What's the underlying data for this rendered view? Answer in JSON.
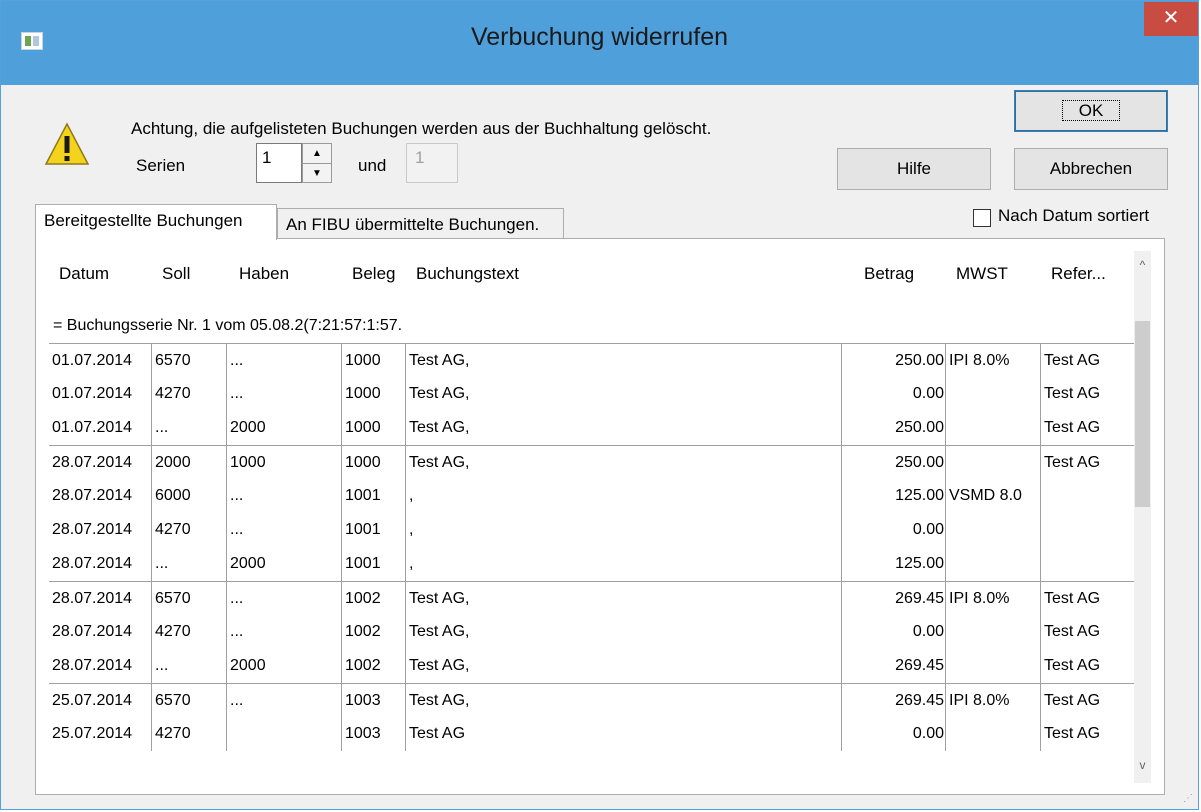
{
  "window": {
    "title": "Verbuchung widerrufen",
    "close_glyph": "✕"
  },
  "warning": {
    "icon": "warning-icon",
    "text": "Achtung, die aufgelisteten Buchungen werden aus der Buchhaltung gelöscht."
  },
  "series": {
    "label": "Serien",
    "from_value": "1",
    "and_label": "und",
    "to_value": "1"
  },
  "buttons": {
    "ok": "OK",
    "help": "Hilfe",
    "cancel": "Abbrechen"
  },
  "tabs": [
    {
      "label": "Bereitgestellte Buchungen",
      "active": true
    },
    {
      "label": "An FIBU übermittelte Buchungen.",
      "active": false
    }
  ],
  "sort": {
    "label": "Nach Datum sortiert",
    "checked": false
  },
  "table": {
    "columns": [
      "Datum",
      "Soll",
      "Haben",
      "Beleg",
      "Buchungstext",
      "Betrag",
      "MWST",
      "Refer..."
    ],
    "series_header": "= Buchungsserie Nr. 1 vom 05.08.2(7:21:57:1:57.",
    "groups": [
      {
        "rows": [
          [
            "01.07.2014",
            "6570",
            "...",
            "1000",
            "Test AG,",
            "250.00",
            "IPI 8.0%",
            "Test AG"
          ],
          [
            "01.07.2014",
            "4270",
            "...",
            "1000",
            "Test AG,",
            "0.00",
            "",
            "Test AG"
          ],
          [
            "01.07.2014",
            "...",
            "2000",
            "1000",
            "Test AG,",
            "250.00",
            "",
            "Test AG"
          ]
        ]
      },
      {
        "rows": [
          [
            "28.07.2014",
            "2000",
            "1000",
            "1000",
            "Test AG,",
            "250.00",
            "",
            "Test AG"
          ],
          [
            "28.07.2014",
            "6000",
            "...",
            "1001",
            ",",
            "125.00",
            "VSMD 8.0",
            ""
          ],
          [
            "28.07.2014",
            "4270",
            "...",
            "1001",
            ",",
            "0.00",
            "",
            ""
          ],
          [
            "28.07.2014",
            "...",
            "2000",
            "1001",
            ",",
            "125.00",
            "",
            ""
          ]
        ]
      },
      {
        "rows": [
          [
            "28.07.2014",
            "6570",
            "...",
            "1002",
            "Test AG,",
            "269.45",
            "IPI 8.0%",
            "Test AG"
          ],
          [
            "28.07.2014",
            "4270",
            "...",
            "1002",
            "Test AG,",
            "0.00",
            "",
            "Test AG"
          ],
          [
            "28.07.2014",
            "...",
            "2000",
            "1002",
            "Test AG,",
            "269.45",
            "",
            "Test AG"
          ]
        ]
      },
      {
        "rows": [
          [
            "25.07.2014",
            "6570",
            "...",
            "1003",
            "Test AG,",
            "269.45",
            "IPI 8.0%",
            "Test AG"
          ],
          [
            "25.07.2014",
            "4270",
            "",
            "1003",
            "Test AG",
            "0.00",
            "",
            "Test AG"
          ]
        ]
      }
    ]
  },
  "scrollbar": {
    "up_glyph": "^",
    "down_glyph": "v"
  },
  "colors": {
    "titlebar": "#4f9fdb",
    "close_button": "#c94c43",
    "dialog_bg": "#f0f0f0"
  }
}
